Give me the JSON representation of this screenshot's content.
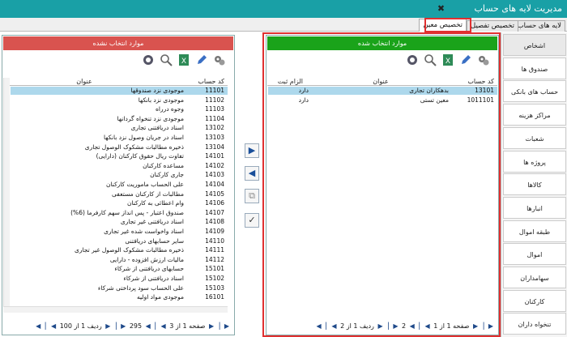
{
  "window": {
    "title": "مدیریت لایه های حساب"
  },
  "tabs": [
    "لایه های حساب",
    "تخصیص تفصیل",
    "تخصیص معین"
  ],
  "left_panel": {
    "header": "موارد انتخاب نشده",
    "header_color": "#d9534f",
    "columns": {
      "code": "کد حساب",
      "title": "عنوان"
    },
    "rows": [
      {
        "code": "11101",
        "title": "موجودی نزد صندوقها"
      },
      {
        "code": "11102",
        "title": "موجودی نزد بانکها"
      },
      {
        "code": "11103",
        "title": "وجوه درراه"
      },
      {
        "code": "11104",
        "title": "موجودی نزد تنخواه گردانها"
      },
      {
        "code": "13102",
        "title": "اسناد دریافتنی تجاری"
      },
      {
        "code": "13103",
        "title": "اسناد در جریان وصول نزد بانکها"
      },
      {
        "code": "13104",
        "title": "ذخیره مطالبات مشکوک الوصول تجاری"
      },
      {
        "code": "14101",
        "title": "تفاوت ریال حقوق کارکنان (دارایی)"
      },
      {
        "code": "14102",
        "title": "مساعده کارکنان"
      },
      {
        "code": "14103",
        "title": "جاری کارکنان"
      },
      {
        "code": "14104",
        "title": "علی الحساب ماموریت کارکنان"
      },
      {
        "code": "14105",
        "title": "مطالبات از کارکنان مستعفی"
      },
      {
        "code": "14106",
        "title": "وام اعطائی به کارکنان"
      },
      {
        "code": "14107",
        "title": "صندوق اعتبار - پس انداز سهم کارفرما (6%)"
      },
      {
        "code": "14108",
        "title": "اسناد دریافتنی غیر تجاری"
      },
      {
        "code": "14109",
        "title": "اسناد واخواست شده غیر تجاری"
      },
      {
        "code": "14110",
        "title": "سایر حسابهای دریافتنی"
      },
      {
        "code": "14111",
        "title": "ذخیره مطالبات مشکوک الوصول غیر تجاری"
      },
      {
        "code": "14112",
        "title": "مالیات ارزش افزوده - دارایی"
      },
      {
        "code": "15101",
        "title": "حسابهای دریافتنی از شرکاء"
      },
      {
        "code": "15102",
        "title": "اسناد دریافتنی از شرکاء"
      },
      {
        "code": "15103",
        "title": "علی الحساب سود پرداختی شرکاء"
      },
      {
        "code": "16101",
        "title": "موجودی مواد اولیه"
      }
    ],
    "pager": {
      "page": "صفحه 1 از 3",
      "total": "295",
      "rows_per_page": "ردیف 1 از 100"
    }
  },
  "right_panel": {
    "header": "موارد انتخاب شده",
    "header_color": "#1aa31a",
    "columns": {
      "code": "کد حساب",
      "title": "عنوان",
      "required": "الزام ثبت"
    },
    "rows": [
      {
        "code": "13101",
        "title": "بدهکاران تجاری",
        "required": "دارد"
      },
      {
        "code": "1011101",
        "title": "معین تستی",
        "required": "دارد"
      }
    ],
    "pager": {
      "page": "صفحه 1 از 1",
      "total": "2",
      "rows_per_page": "ردیف 1 از 2"
    }
  },
  "sidebar": [
    "اشخاص",
    "صندوق ها",
    "حساب های بانکی",
    "مراکز هزینه",
    "شعبات",
    "پروژه ها",
    "کالاها",
    "انبارها",
    "طبقه اموال",
    "اموال",
    "سهامداران",
    "کارکنان",
    "تنخواه داران"
  ],
  "icons": {
    "settings": "gears-icon",
    "edit": "pencil-icon",
    "excel": "excel-icon",
    "search": "search-icon",
    "refresh": "refresh-icon"
  }
}
